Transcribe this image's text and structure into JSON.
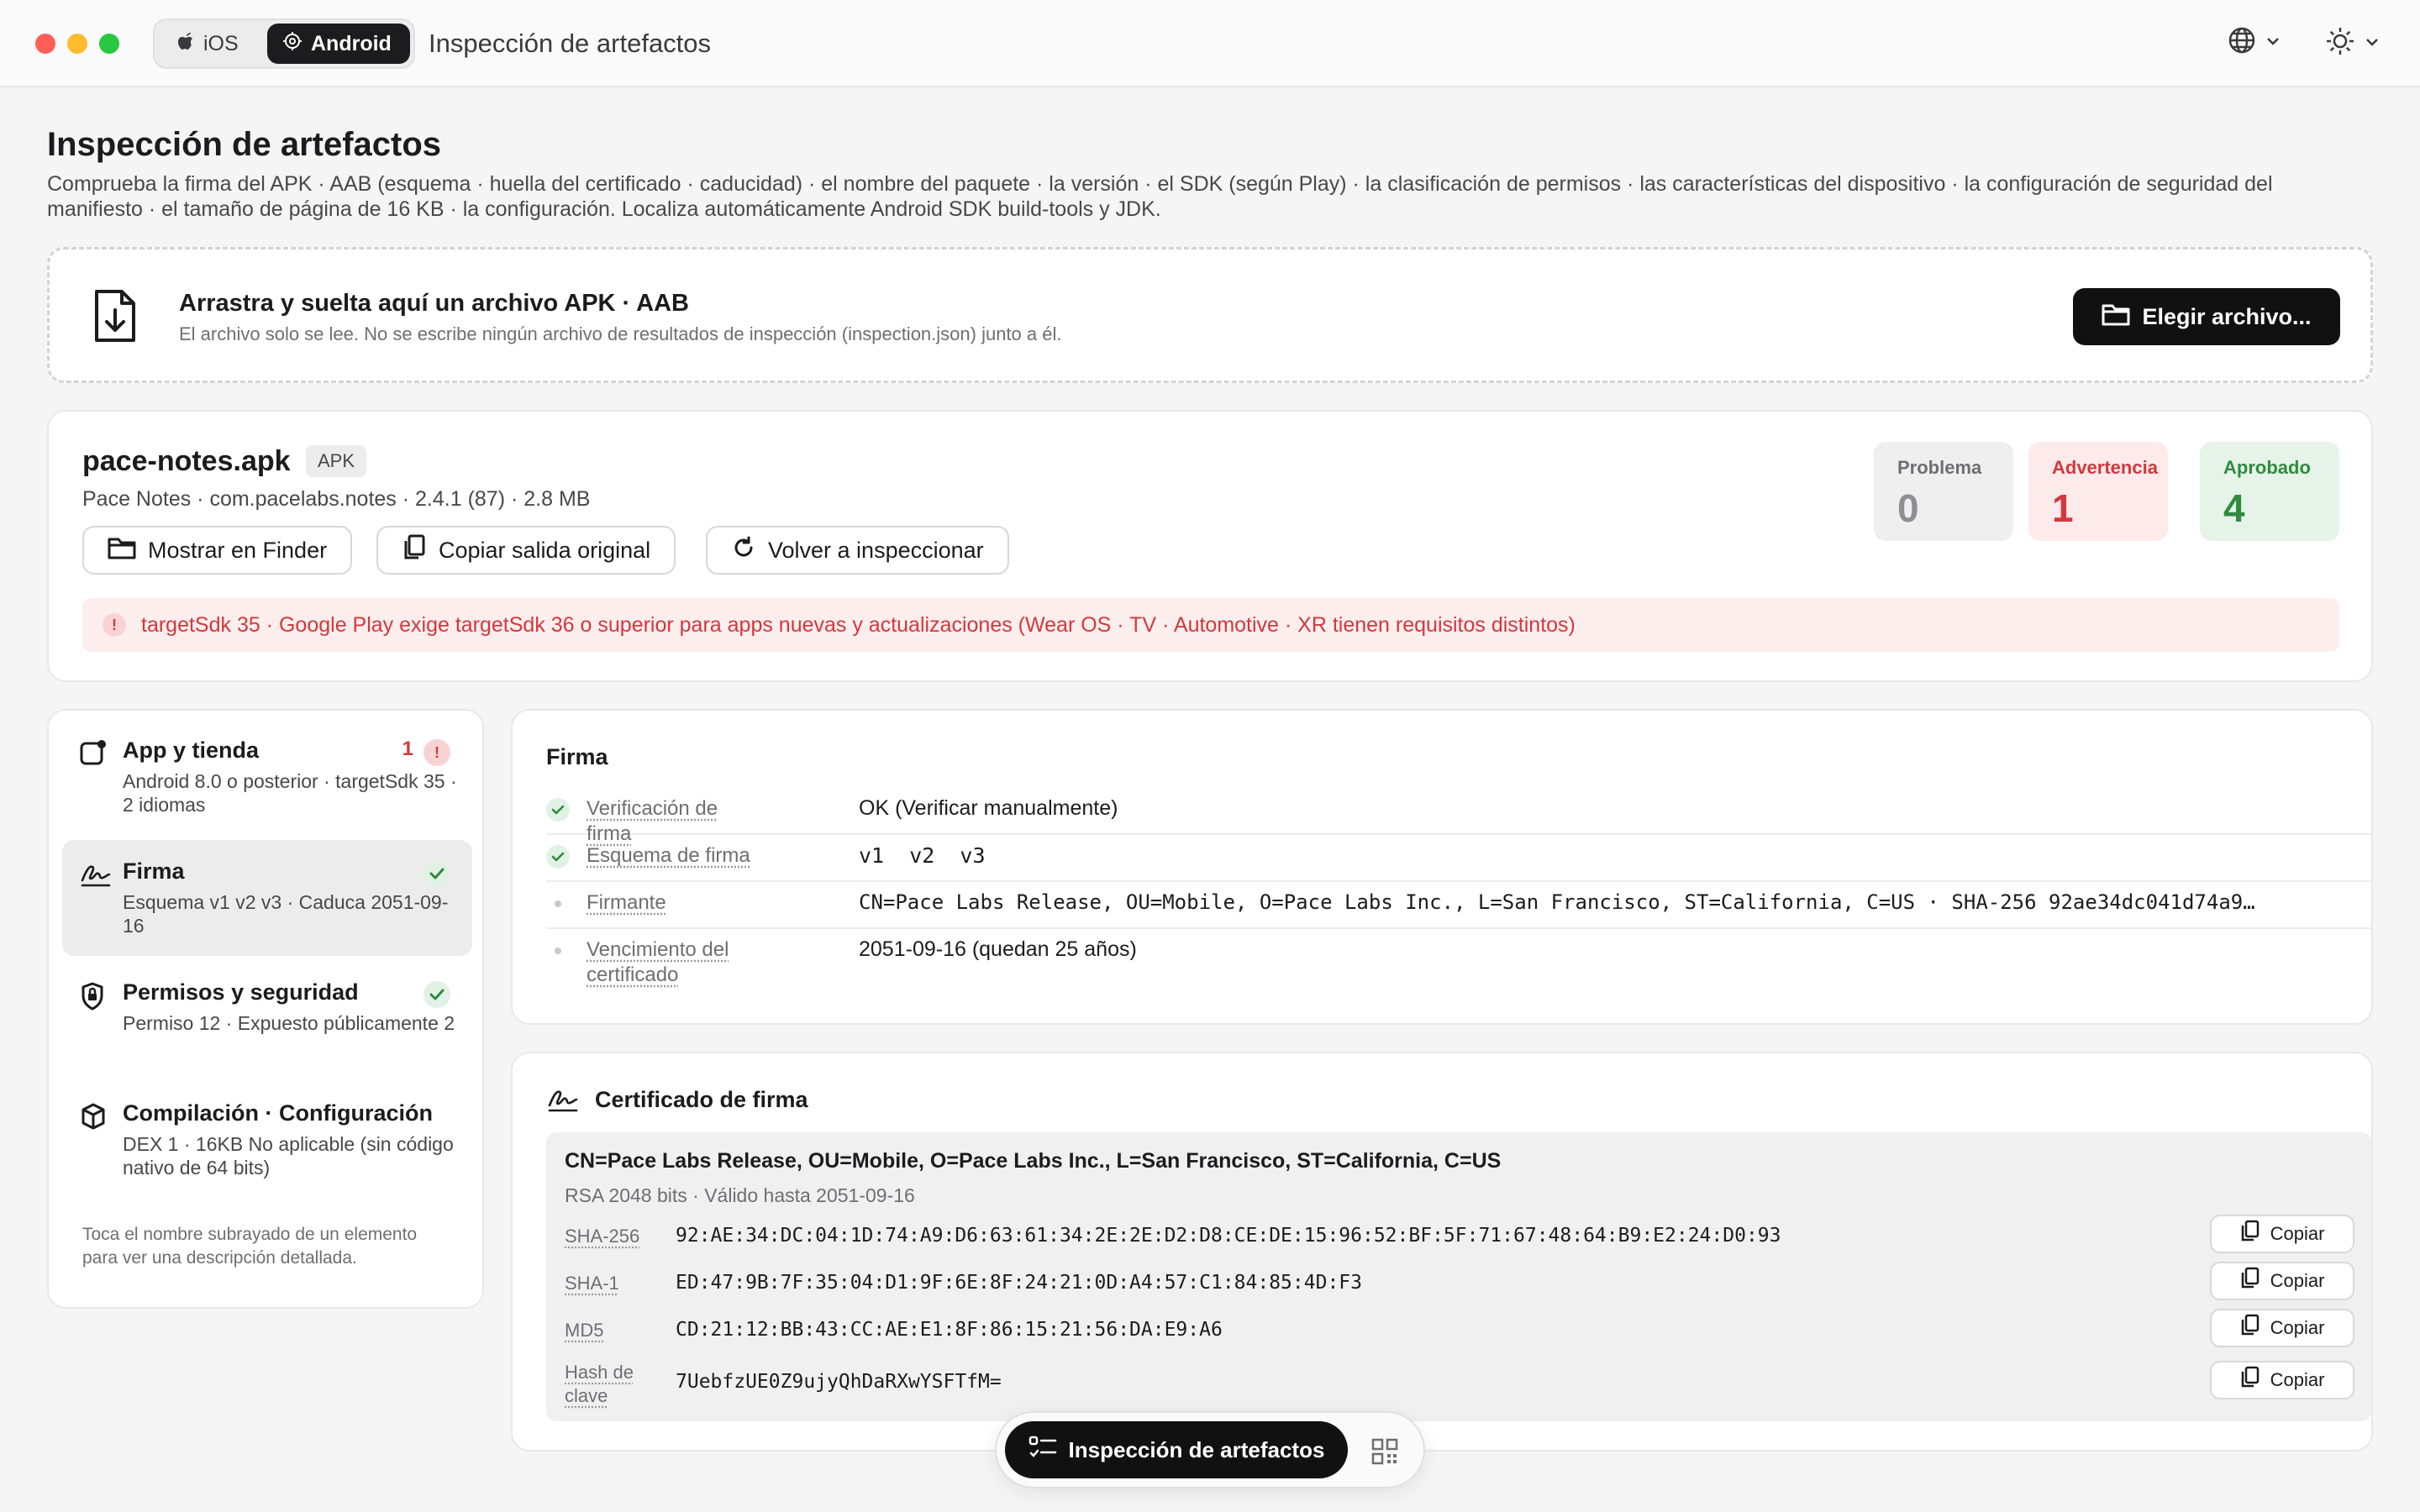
{
  "window": {
    "title": "Inspección de artefactos",
    "platform_tabs": [
      {
        "label": "iOS",
        "active": false
      },
      {
        "label": "Android",
        "active": true
      }
    ]
  },
  "header": {
    "title": "Inspección de artefactos",
    "description": "Comprueba la firma del APK · AAB (esquema · huella del certificado · caducidad) · el nombre del paquete · la versión · el SDK (según Play) · la clasificación de permisos · las características del dispositivo · la configuración de seguridad del manifiesto · el tamaño de página de 16 KB · la configuración. Localiza automáticamente Android SDK build-tools y JDK."
  },
  "dropzone": {
    "title": "Arrastra y suelta aquí un archivo APK · AAB",
    "subtitle": "El archivo solo se lee. No se escribe ningún archivo de resultados de inspección (inspection.json) junto a él.",
    "button_label": "Elegir archivo..."
  },
  "file": {
    "name": "pace-notes.apk",
    "type_tag": "APK",
    "meta": "Pace Notes · com.pacelabs.notes · 2.4.1 (87) · 2.8 MB",
    "actions": {
      "show_finder": "Mostrar en Finder",
      "copy_output": "Copiar salida original",
      "reinspect": "Volver a inspeccionar"
    },
    "stats": {
      "problem": {
        "label": "Problema",
        "value": "0",
        "color": "#8e8e93"
      },
      "warning": {
        "label": "Advertencia",
        "value": "1",
        "color": "#d2383d"
      },
      "passed": {
        "label": "Aprobado",
        "value": "4",
        "color": "#2e8b3f"
      }
    },
    "warning_message": "targetSdk 35 · Google Play exige targetSdk 36 o superior para apps nuevas y actualizaciones (Wear OS · TV · Automotive · XR tienen requisitos distintos)"
  },
  "sidebar": {
    "items": [
      {
        "title": "App y tienda",
        "subtitle": "Android 8.0 o posterior · targetSdk 35 · 2 idiomas",
        "badge_count": "1",
        "badge_icon": "exclamation-icon"
      },
      {
        "title": "Firma",
        "subtitle": "Esquema v1 v2 v3 · Caduca 2051-09-16",
        "status_icon": "check-icon"
      },
      {
        "title": "Permisos y seguridad",
        "subtitle": "Permiso 12 · Expuesto públicamente 2",
        "status_icon": "check-icon"
      },
      {
        "title": "Compilación · Configuración",
        "subtitle": "DEX 1 · 16KB No aplicable (sin código nativo de 64 bits)"
      }
    ],
    "note": "Toca el nombre subrayado de un elemento para ver una descripción detallada."
  },
  "signature": {
    "title": "Firma",
    "rows": [
      {
        "key": "Verificación de firma",
        "value": "OK (Verificar manualmente)",
        "status": "check"
      },
      {
        "key": "Esquema de firma",
        "value": "v1  v2  v3",
        "status": "check"
      },
      {
        "key": "Firmante",
        "value": "CN=Pace Labs Release, OU=Mobile, O=Pace Labs Inc., L=San Francisco, ST=California, C=US · SHA-256 92ae34dc041d74a9…",
        "status": "dot"
      },
      {
        "key": "Vencimiento del certificado",
        "value": "2051-09-16 (quedan 25 años)",
        "status": "dot"
      }
    ]
  },
  "certificate": {
    "title": "Certificado de firma",
    "subject": "CN=Pace Labs Release, OU=Mobile, O=Pace Labs Inc., L=San Francisco, ST=California, C=US",
    "meta": "RSA 2048 bits · Válido hasta 2051-09-16",
    "copy_label": "Copiar",
    "hashes": [
      {
        "key": "SHA-256",
        "value": "92:AE:34:DC:04:1D:74:A9:D6:63:61:34:2E:2E:D2:D8:CE:DE:15:96:52:BF:5F:71:67:48:64:B9:E2:24:D0:93"
      },
      {
        "key": "SHA-1",
        "value": "ED:47:9B:7F:35:04:D1:9F:6E:8F:24:21:0D:A4:57:C1:84:85:4D:F3"
      },
      {
        "key": "MD5",
        "value": "CD:21:12:BB:43:CC:AE:E1:8F:86:15:21:56:DA:E9:A6"
      },
      {
        "key": "Hash de clave",
        "value": "7UebfzUE0Z9ujyQhDaRXwYSFTfM="
      }
    ]
  },
  "bottom_bar": {
    "label": "Inspección de artefactos"
  },
  "colors": {
    "accent_dark": "#111111",
    "warning_red": "#d2383d",
    "success_green": "#2e8b3f"
  }
}
